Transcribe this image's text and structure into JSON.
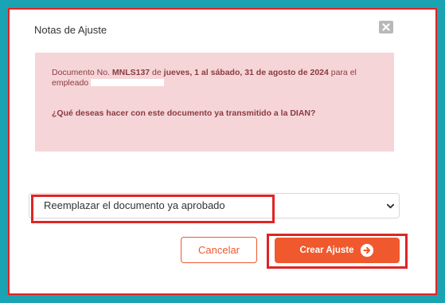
{
  "dialog": {
    "title": "Notas de Ajuste",
    "close_icon": "close-icon"
  },
  "alert": {
    "doc_prefix": "Documento No. ",
    "doc_number": "MNLS137",
    "doc_of": " de ",
    "period": "jueves, 1 al sábado, 31 de agosto de 2024",
    "doc_for": " para el empleado",
    "question": "¿Qué deseas hacer con este documento ya transmitido a la DIAN?"
  },
  "action_select": {
    "selected_value": "Reemplazar el documento ya aprobado",
    "icon": "chevron-down-icon"
  },
  "buttons": {
    "cancel_label": "Cancelar",
    "create_label": "Crear Ajuste",
    "create_icon": "arrow-right-circle-icon"
  },
  "colors": {
    "background": "#1aa3b3",
    "accent": "#f0592d",
    "alert_bg": "#f6d5d8",
    "alert_text": "#8a3b40",
    "highlight": "#e02424"
  }
}
